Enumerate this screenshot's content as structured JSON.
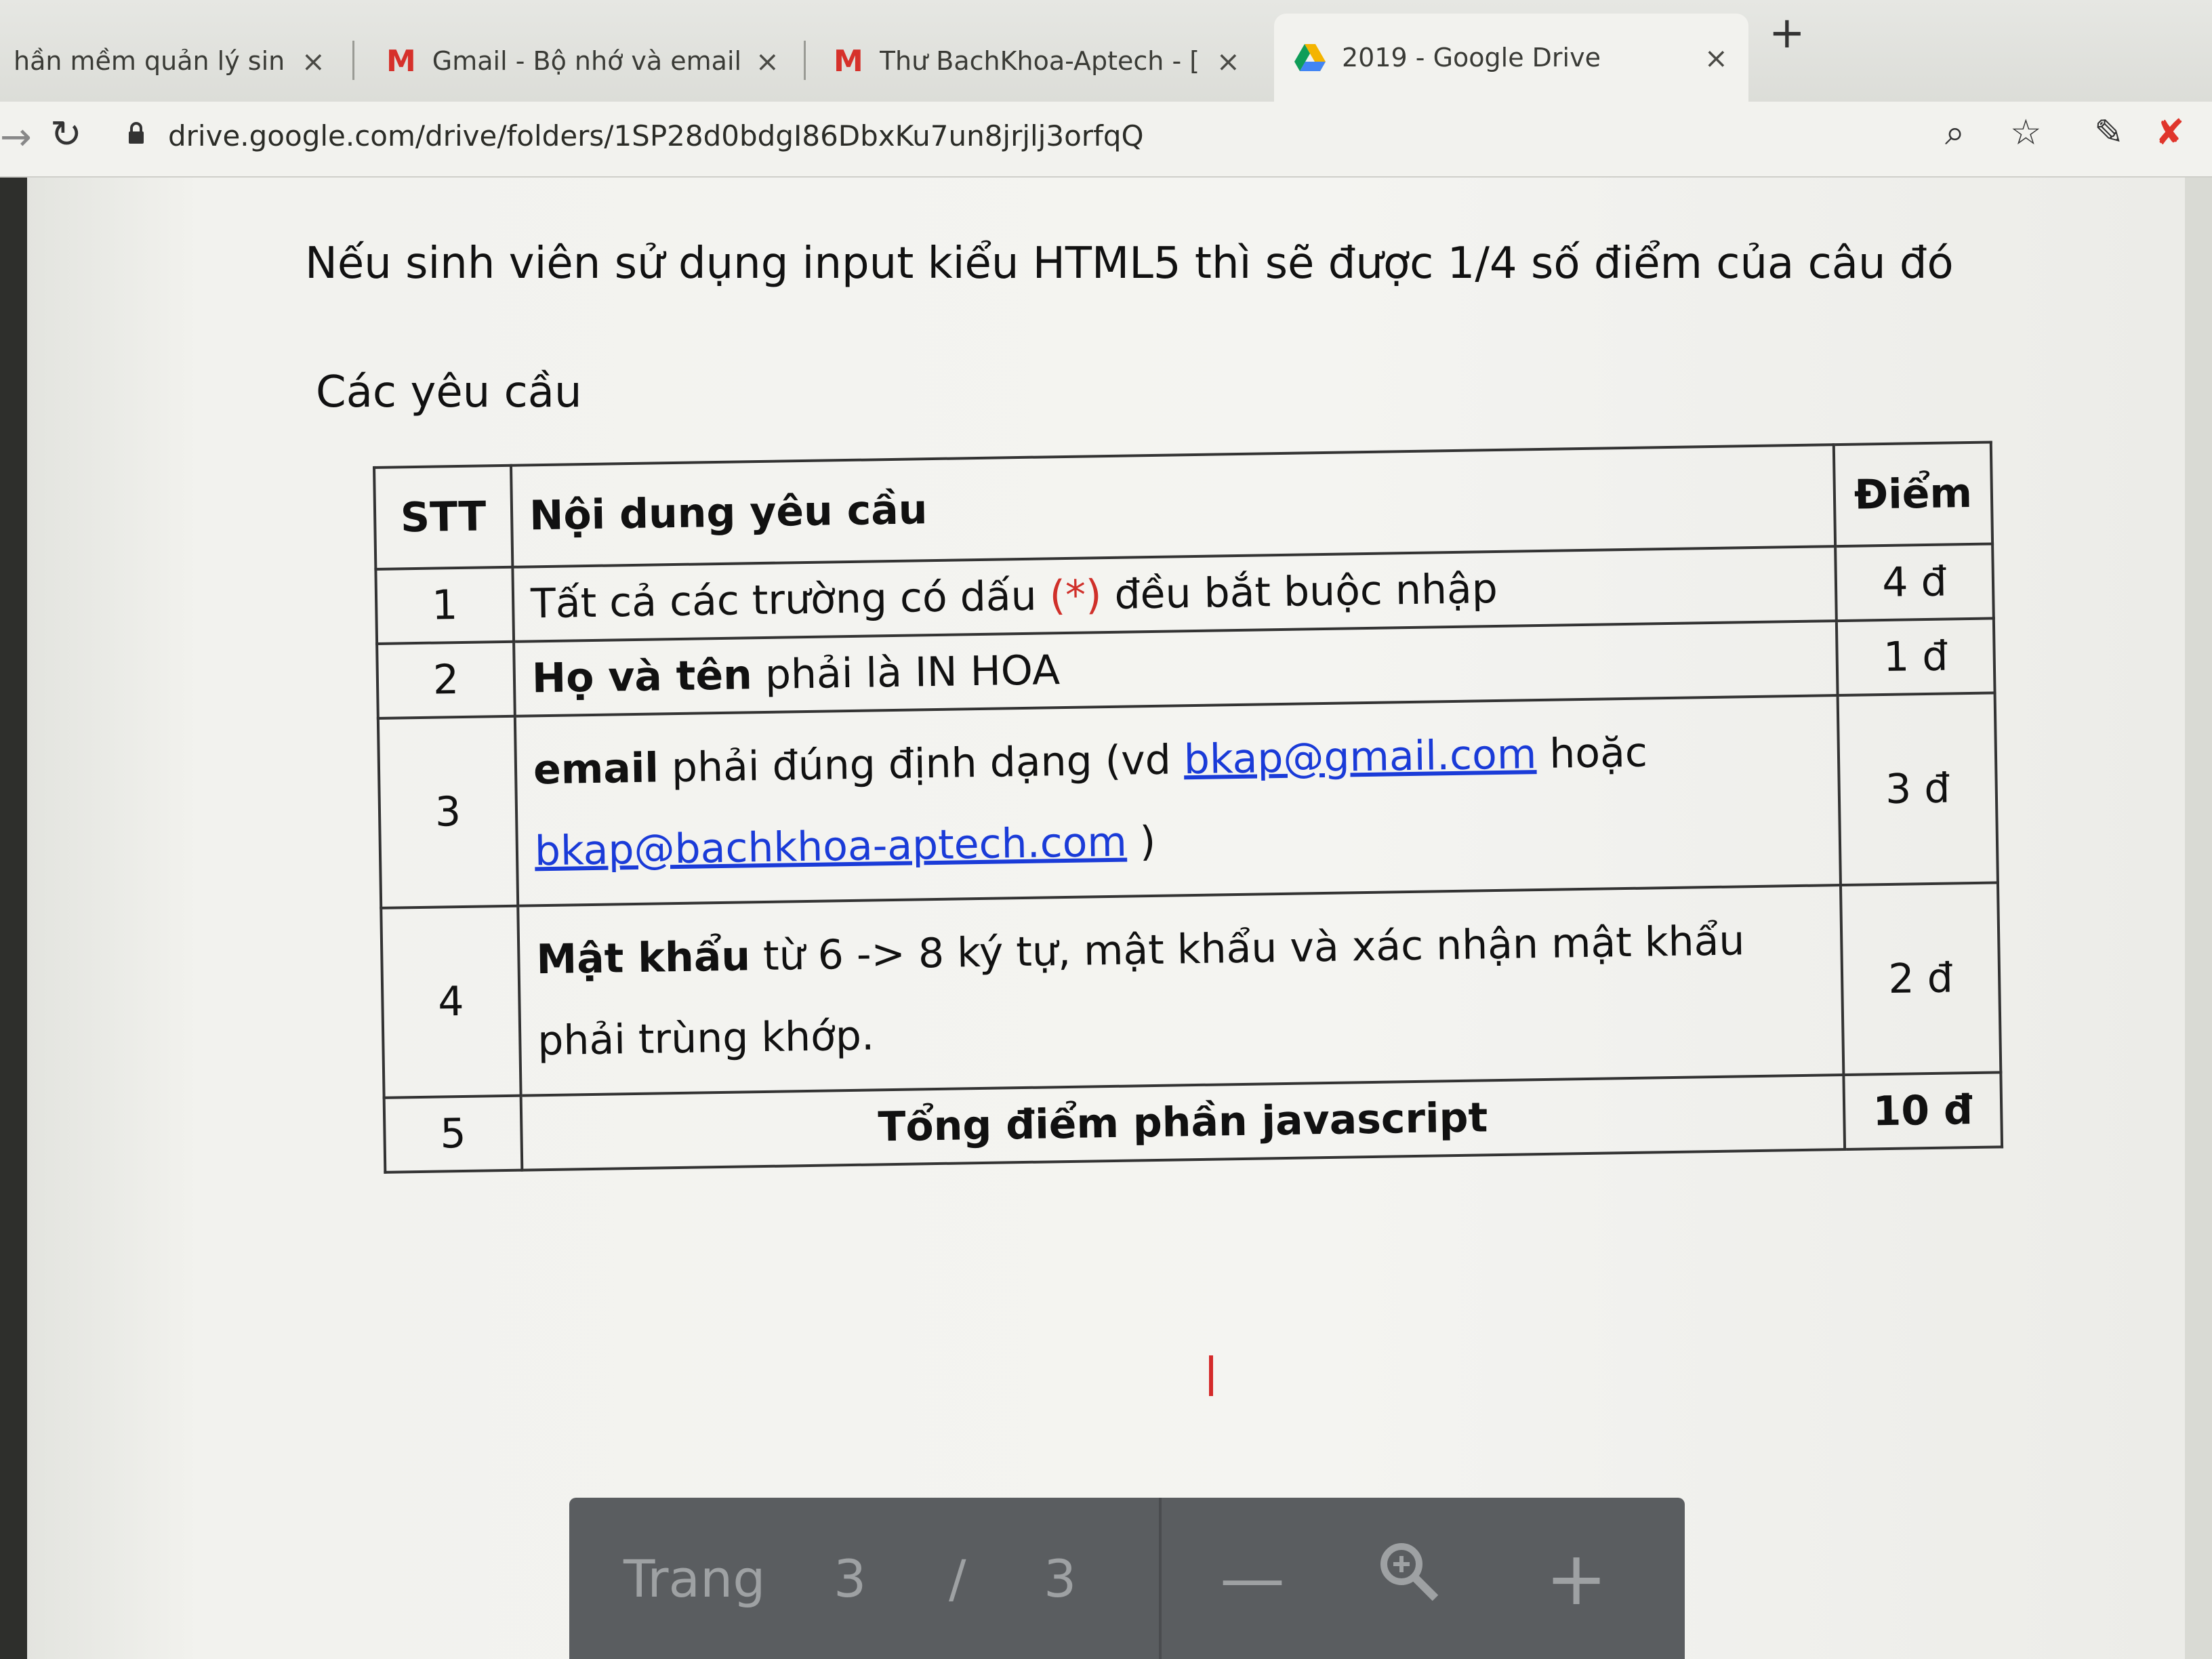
{
  "browser": {
    "tabs": [
      {
        "label": "hần mềm quản lý sinh viên Bac",
        "icon": "bkap-favicon"
      },
      {
        "label": "Gmail - Bộ nhớ và email miễn ph",
        "icon": "gmail-icon"
      },
      {
        "label": "Thư BachKhoa-Aptech - [NANGC",
        "icon": "gmail-icon"
      },
      {
        "label": "2019 - Google Drive",
        "icon": "google-drive-icon",
        "active": true
      }
    ],
    "new_tab": "+",
    "close_glyph": "×",
    "url": "drive.google.com/drive/folders/1SP28d0bdgI86DbxKu7un8jrjlj3orfqQ"
  },
  "document": {
    "note": "Nếu sinh viên sử dụng input kiểu HTML5 thì sẽ được 1/4 số điểm của câu đó",
    "section_title": "Các yêu cầu",
    "table": {
      "headers": [
        "STT",
        "Nội dung yêu cầu",
        "Điểm"
      ],
      "rows": [
        {
          "stt": "1",
          "pre": "Tất cả các trường có dấu ",
          "asterisk": "(*)",
          "post": " đều bắt buộc nhập",
          "points": "4 đ"
        },
        {
          "stt": "2",
          "bold": "Họ và tên",
          "rest": " phải là IN HOA",
          "points": "1 đ"
        },
        {
          "stt": "3",
          "bold": "email",
          "rest": " phải đúng định dạng (vd ",
          "link1": "bkap@gmail.com",
          "mid": " hoặc",
          "link2": "bkap@bachkhoa-aptech.com",
          "end": " )",
          "points": "3 đ"
        },
        {
          "stt": "4",
          "bold": "Mật khẩu",
          "rest": " từ 6 -> 8 ký tự, mật khẩu và xác nhận mật khẩu",
          "cont": "phải trùng khớp.",
          "points": "2 đ"
        }
      ],
      "total": {
        "stt": "5",
        "label": "Tổng điểm phần javascript",
        "points": "10 đ"
      }
    }
  },
  "page_nav": {
    "label": "Trang",
    "current": "3",
    "separator": "/",
    "total": "3",
    "zoom_out": "—",
    "zoom_icon": "zoom-icon",
    "zoom_in": "+"
  }
}
